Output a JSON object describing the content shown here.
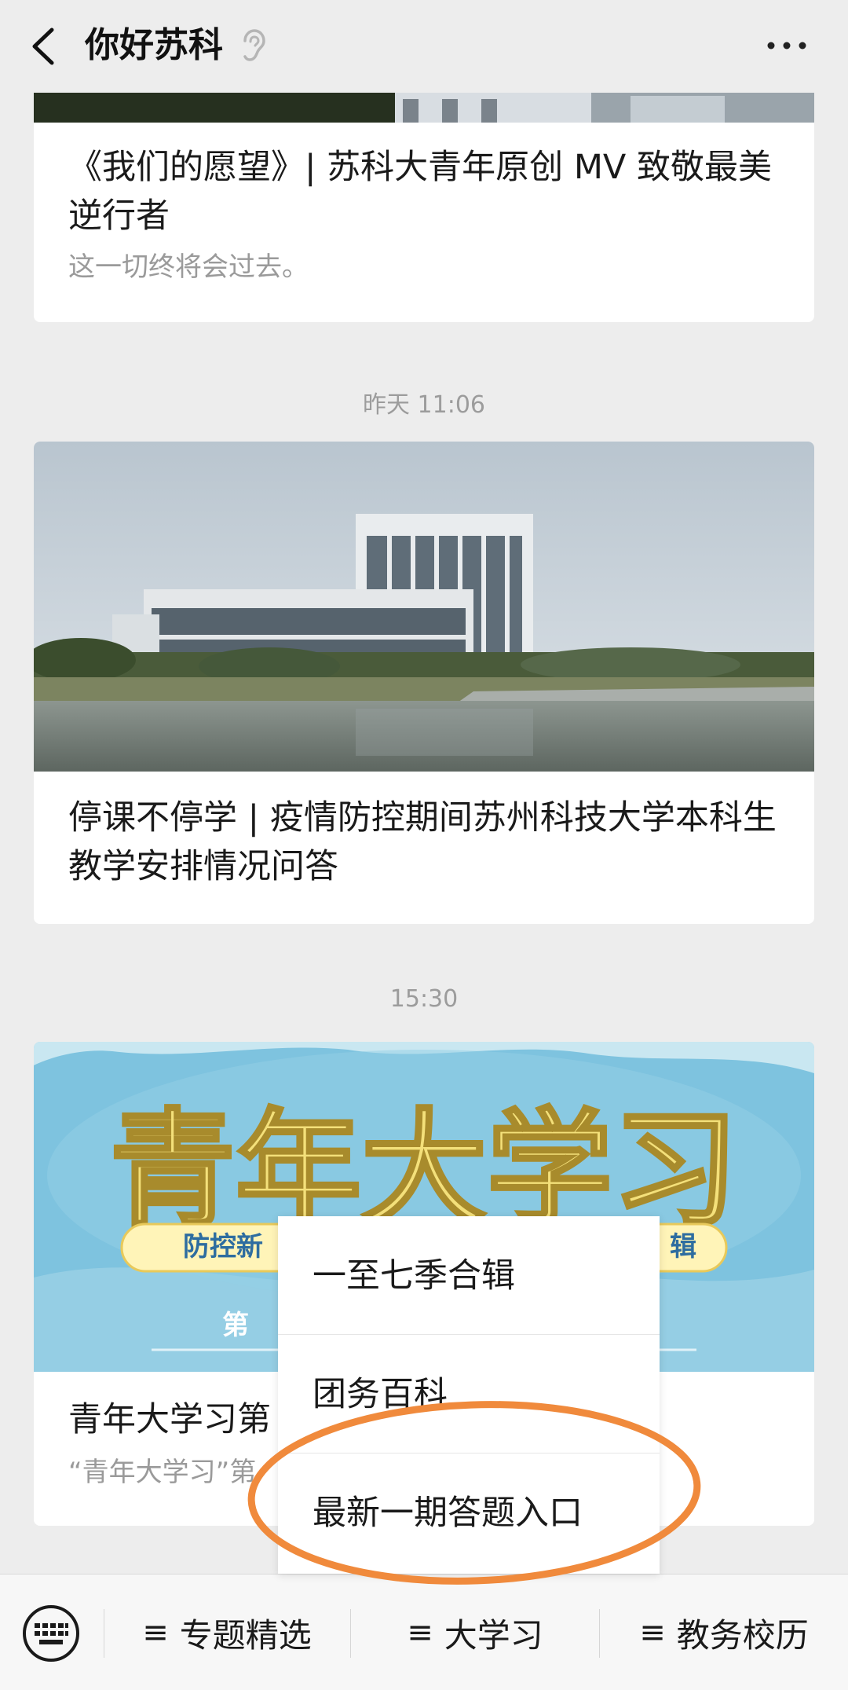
{
  "header": {
    "title": "你好苏科",
    "back_icon": "chevron-left-icon",
    "listen_icon": "ear-icon",
    "more_icon": "more-dots-icon"
  },
  "feed": {
    "card1": {
      "title": "《我们的愿望》| 苏科大青年原创 MV 致敬最美逆行者",
      "subtitle": "这一切终将会过去。"
    },
    "time2": "昨天 11:06",
    "card2": {
      "title": "停课不停学 | 疫情防控期间苏州科技大学本科生教学安排情况问答"
    },
    "time3": "15:30",
    "card3": {
      "cover_text": "青年大学习",
      "cover_banner": "防控新",
      "cover_banner_right": "辑",
      "cover_season": "第",
      "title": "青年大学习第",
      "subtitle": "“青年大学习”第"
    }
  },
  "popup_menu": {
    "items": [
      "一至七季合辑",
      "团务百科",
      "最新一期答题入口"
    ]
  },
  "menubar": {
    "keyboard_icon": "keyboard-icon",
    "items": [
      "专题精选",
      "大学习",
      "教务校历"
    ],
    "glyph": "≡"
  },
  "colors": {
    "background": "#ededed",
    "annotation_circle": "#f08a3c",
    "cover_sky": "#c9d3dc",
    "quiz_cover": "#7ec3df"
  }
}
